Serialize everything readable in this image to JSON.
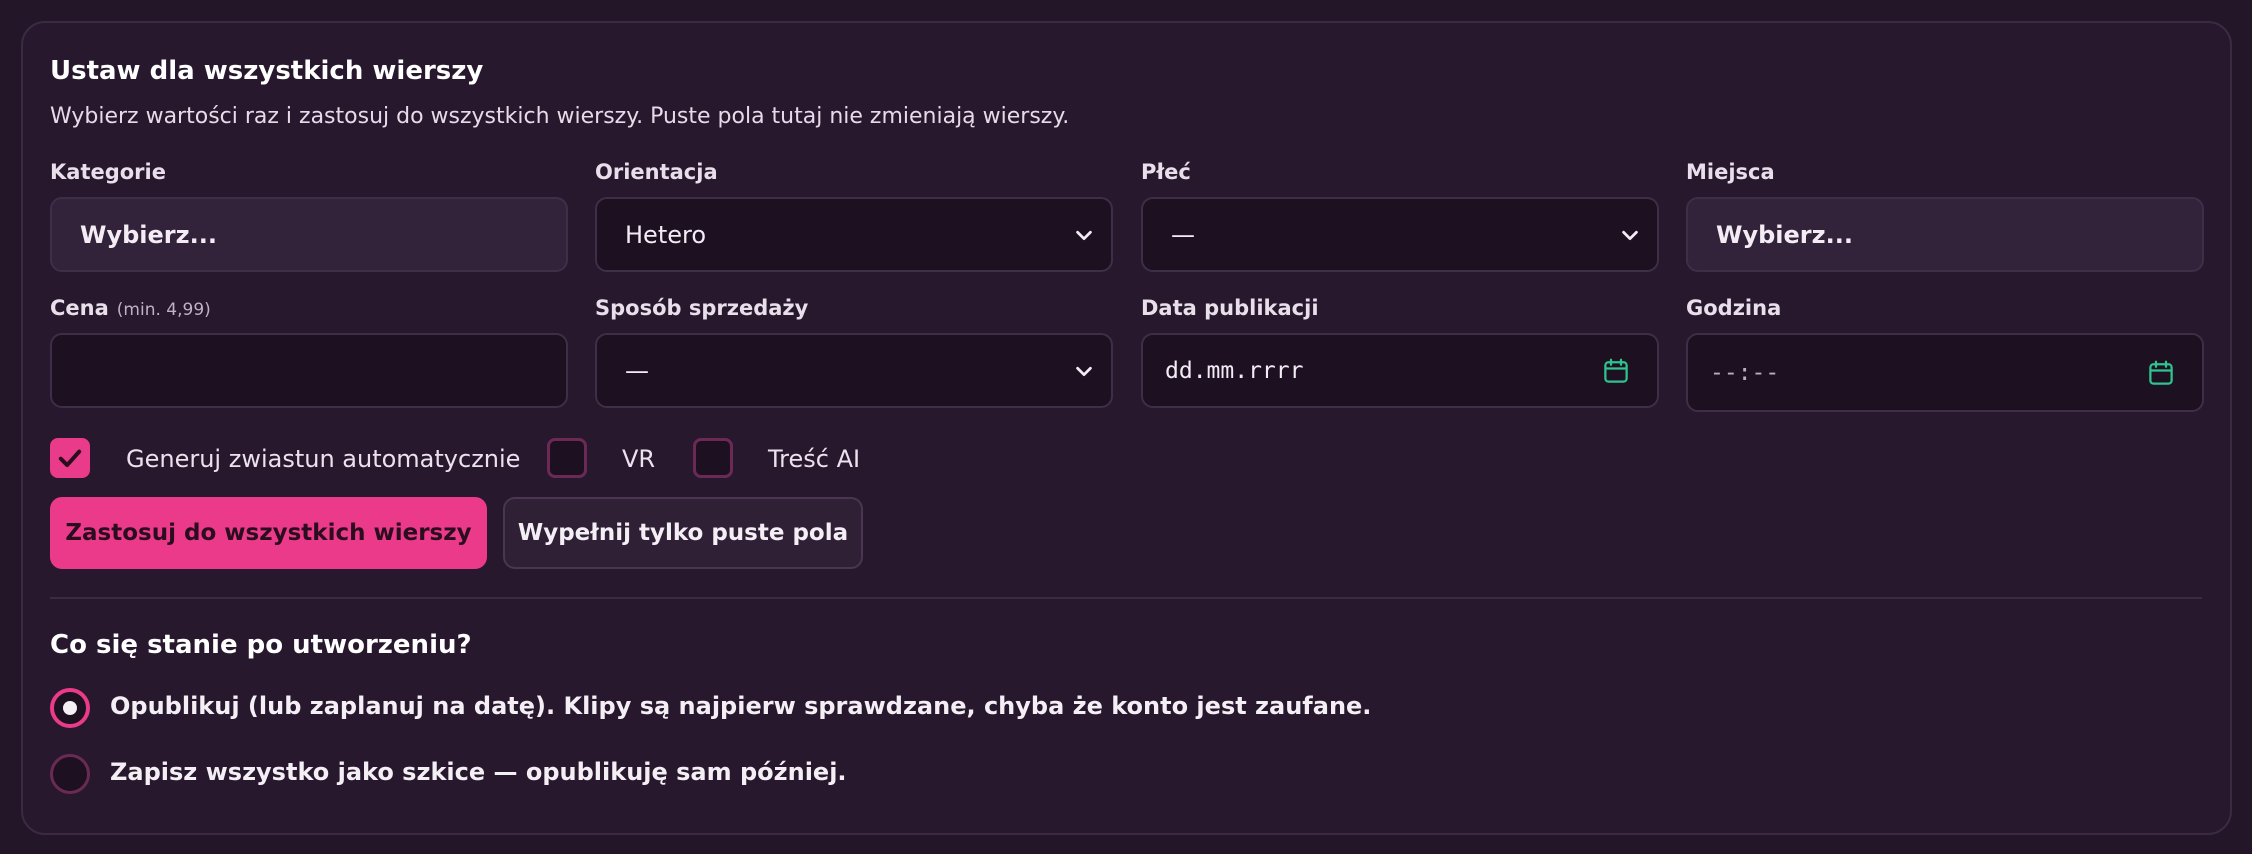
{
  "bulk": {
    "title": "Ustaw dla wszystkich wierszy",
    "subtitle": "Wybierz wartości raz i zastosuj do wszystkich wierszy. Puste pola tutaj nie zmieniają wierszy."
  },
  "fields": {
    "kategorie": {
      "label": "Kategorie",
      "value": "Wybierz..."
    },
    "orientacja": {
      "label": "Orientacja",
      "value": "Hetero"
    },
    "plec": {
      "label": "Płeć",
      "value": "—"
    },
    "miejsca": {
      "label": "Miejsca",
      "value": "Wybierz..."
    },
    "cena": {
      "label": "Cena",
      "hint": "(min. 4,99)",
      "value": ""
    },
    "sposob": {
      "label": "Sposób sprzedaży",
      "value": "—"
    },
    "data": {
      "label": "Data publikacji",
      "value": "dd.mm.rrrr"
    },
    "godzina": {
      "label": "Godzina",
      "value": "--:--"
    }
  },
  "checks": {
    "zwiastun": {
      "label": "Generuj zwiastun automatycznie",
      "checked": true
    },
    "vr": {
      "label": "VR",
      "checked": false
    },
    "ai": {
      "label": "Treść AI",
      "checked": false
    }
  },
  "buttons": {
    "apply_all": "Zastosuj do wszystkich wierszy",
    "fill_empty": "Wypełnij tylko puste pola"
  },
  "after": {
    "title": "Co się stanie po utworzeniu?",
    "options": [
      {
        "label": "Opublikuj (lub zaplanuj na datę). Klipy są najpierw sprawdzane, chyba że konto jest zaufane.",
        "selected": true
      },
      {
        "label": "Zapisz wszystko jako szkice — opublikuję sam później.",
        "selected": false
      }
    ]
  },
  "colors": {
    "accent": "#ec3a8a",
    "calendar_icon": "#2fc48f",
    "background": "#231628"
  },
  "icons": {
    "select_chevron": "chevron-down-icon",
    "date_picker": "calendar-icon",
    "checkbox_check": "check-icon"
  }
}
